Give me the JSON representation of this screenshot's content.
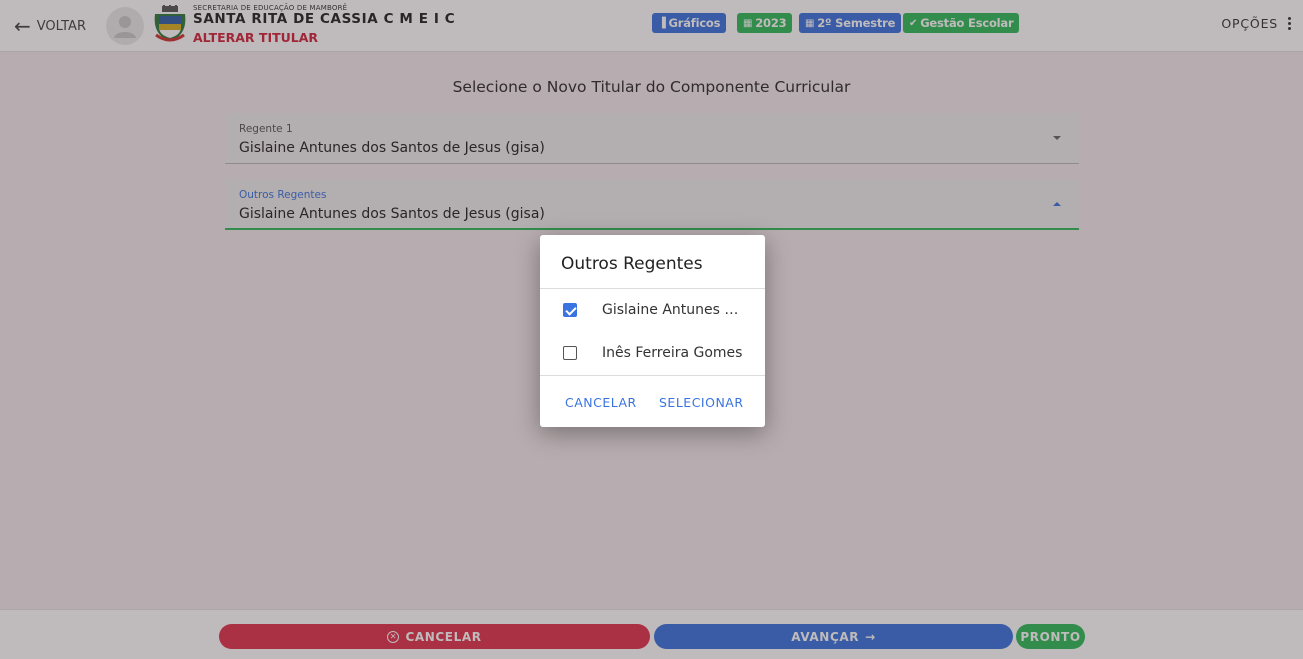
{
  "header": {
    "back_label": "VOLTAR",
    "org_name": "SECRETARIA DE EDUCAÇÃO DE MAMBORÊ",
    "school_name": "SANTA RITA DE CASSIA C M E I C",
    "subtitle": "ALTERAR TITULAR",
    "chips": {
      "graficos": "Gráficos",
      "year": "2023",
      "semester": "2º Semestre",
      "gestao": "Gestão Escolar"
    },
    "options_label": "OPÇÕES"
  },
  "main": {
    "title": "Selecione o Novo Titular do Componente Curricular",
    "regente": {
      "label": "Regente 1",
      "value": "Gislaine Antunes dos Santos de Jesus (gisa)"
    },
    "outros": {
      "label": "Outros Regentes",
      "value": "Gislaine Antunes dos Santos de Jesus (gisa)"
    }
  },
  "dialog": {
    "title": "Outros Regentes",
    "options": [
      {
        "label": "Gislaine Antunes dos Santos de Jesus (gisa)",
        "checked": true
      },
      {
        "label": "Inês Ferreira Gomes",
        "checked": false
      }
    ],
    "cancel_label": "CANCELAR",
    "select_label": "SELECIONAR"
  },
  "footer": {
    "cancel_label": "CANCELAR",
    "next_label": "AVANÇAR",
    "done_label": "PRONTO"
  },
  "colors": {
    "accent_blue": "#3a74e0",
    "accent_green": "#2dbd5c",
    "accent_red": "#e0344c"
  }
}
